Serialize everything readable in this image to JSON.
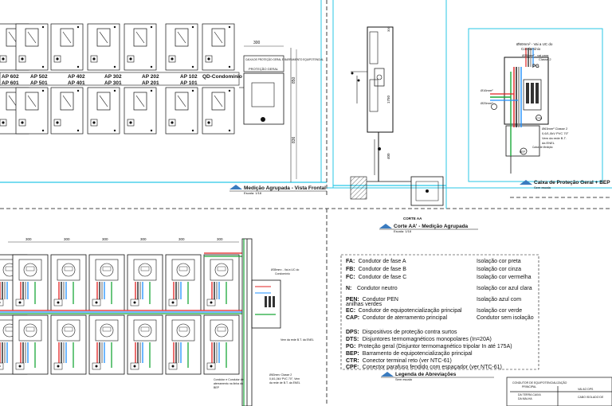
{
  "front_view": {
    "apartments_row": [
      "AP 602",
      "AP 502",
      "AP 402",
      "AP 302",
      "AP 202",
      "AP 102"
    ],
    "apartments_row2": [
      "AP 601",
      "AP 501",
      "AP 401",
      "AP 301",
      "AP 201",
      "AP 101"
    ],
    "condo_label": "QD-Condomínio",
    "protection_label": "PROTEÇÃO GERAL",
    "box_label": "CAIXA DE PROTEÇÃO GERAL E BARRAMENTO EQUIPOTENCIAL",
    "dims": [
      "300",
      "850",
      "836"
    ],
    "title": "Medição Agrupada - Vista Frontal",
    "scale": "Escala: 1/18"
  },
  "section_view": {
    "dims": [
      "300",
      "1750",
      "400"
    ],
    "section_label": "CORTE AA",
    "title": "Corte AA' - Medição Agrupada",
    "scale": "Escala: 1/18"
  },
  "protection_box": {
    "labels": [
      "Ø50mm² - Vai a UC do",
      "Condomínio",
      "Ø35mm² - vai para",
      "Classe 2",
      "PG",
      "Ø16mm²",
      "Ø25mm²",
      "CTR",
      "Ø63mm² Classe 2",
      "0,6/1,0kV PVC 70°",
      "Vem da rede B.T.",
      "da ENEL",
      "Caixa de Medição",
      "BEP"
    ],
    "title": "Caixa de Proteção Geral + BEP",
    "scale": "Sem escala"
  },
  "wiring_view": {
    "dims": [
      "300",
      "300",
      "300",
      "300",
      "300",
      "300"
    ],
    "labels": [
      "Ø35mm² - Vai a UC do",
      "Condomínio",
      "Vem da rede B.T. da ENEL",
      "Ø63mm² Classe 2",
      "0,6/1,0kV PVC 70°, Vem",
      "da rede de B.T. da ENEL",
      "Condutor e Condutor de",
      "aterramento na linha do",
      "BEP"
    ]
  },
  "legend": {
    "title": "Legenda de Abreviações",
    "scale": "Sem escala",
    "rows": [
      {
        "abbr": "FA:",
        "desc": "Condutor de fase A",
        "note": "Isolação cor preta"
      },
      {
        "abbr": "FB:",
        "desc": "Condutor de fase B",
        "note": "Isolação cor cinza"
      },
      {
        "abbr": "FC:",
        "desc": "Condutor de fase C",
        "note": "Isolação cor vermelha"
      },
      {
        "abbr": "N:",
        "desc": "Condutor neutro",
        "note": "Isolação cor azul clara"
      },
      {
        "abbr": "PEN:",
        "desc": "Condutor PEN",
        "note": "Isolação azul com"
      },
      {
        "abbr": "",
        "desc": "anilhas verdes",
        "note": ""
      },
      {
        "abbr": "EC:",
        "desc": "Condutor de equipotencialização principal",
        "note": "Isolação cor verde"
      },
      {
        "abbr": "CAP:",
        "desc": "Condutor de aterramento principal",
        "note": "Condutor sem isolação"
      },
      {
        "abbr": "DPS:",
        "desc": "Dispositivos de proteção contra surtos",
        "note": ""
      },
      {
        "abbr": "DTS:",
        "desc": "Disjuntores termomagnéticos monopolares (In=20A)",
        "note": ""
      },
      {
        "abbr": "PG:",
        "desc": "Proteção geral (Disjuntor termomagnético tripolar In até 175A)",
        "note": ""
      },
      {
        "abbr": "BEP:",
        "desc": "Barramento de equipotencialização principal",
        "note": ""
      },
      {
        "abbr": "CTR:",
        "desc": "Conector terminal reto (ver NTC-61)",
        "note": ""
      },
      {
        "abbr": "CPF:",
        "desc": "Conector parafuso fendido com espaçador (ver NTC-61)",
        "note": ""
      }
    ]
  },
  "bottom_right": {
    "labels": [
      "CONDUTOR DE EQUIPOTENCIALIZAÇÃO",
      "PRINCIPAL",
      "VAI AO DPS",
      "DA TERRA CAIXA",
      "DA MALHA",
      "CABO ISOLADO DE"
    ]
  }
}
